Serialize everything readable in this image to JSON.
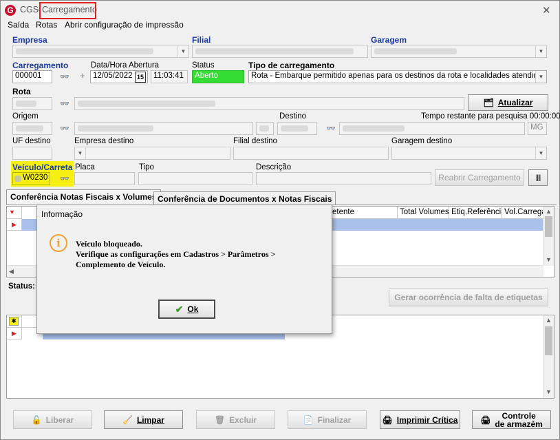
{
  "window": {
    "logo": "G",
    "app_name": "CGS",
    "separator": "-",
    "title": "Carregamento",
    "close_glyph": "✕"
  },
  "menu": [
    "Saída",
    "Rotas",
    "Abrir configuração de impressão"
  ],
  "labels": {
    "empresa": "Empresa",
    "filial": "Filial",
    "garagem": "Garagem",
    "carregamento": "Carregamento",
    "data_hora": "Data/Hora Abertura",
    "status": "Status",
    "tipo_carregamento": "Tipo de carregamento",
    "rota": "Rota",
    "origem": "Origem",
    "destino": "Destino",
    "tempo_restante": "Tempo restante para pesquisa 00:00:00",
    "uf_destino": "UF destino",
    "empresa_destino": "Empresa destino",
    "filial_destino": "Filial destino",
    "garagem_destino": "Garagem destino",
    "veiculo_carreta": "Veículo/Carreta",
    "placa": "Placa",
    "tipo": "Tipo",
    "descricao": "Descrição",
    "status_bottom": "Status:"
  },
  "fields": {
    "carregamento": "000001",
    "date": "12/05/2022",
    "calendar": "15",
    "time": "11:03:41",
    "status": "Aberto",
    "tipo_carregamento": "Rota - Embarque permitido apenas para os destinos da rota e localidades atendidas",
    "uf": "MG",
    "veiculo": "W0230"
  },
  "buttons": {
    "atualizar": "Atualizar",
    "reabrir": "Reabrir Carregamento",
    "gerar_ocorrencia": "Gerar ocorrência de falta de etiquetas",
    "liberar": "Liberar",
    "limpar": "Limpar",
    "excluir": "Excluir",
    "finalizar": "Finalizar",
    "imprimir": "Imprimir Crítica",
    "controle_1": "Controle",
    "controle_2": "de armazém"
  },
  "tabs": [
    "Conferência Notas Fiscais x Volumes",
    "Conferência de Documentos x Notas Fiscais"
  ],
  "grid_headers": [
    "etente",
    "Total Volumes",
    "Etiq.Referência",
    "Vol.Carregad"
  ],
  "dialog": {
    "title": "Informação",
    "line1": "Veículo bloqueado.",
    "line2": "Verifique as configurações em Cadastros > Parâmetros >",
    "line3": "Complemento de Veículo.",
    "ok": "Ok"
  },
  "colors": {
    "status_green": "#33dd33",
    "label_blue": "#1a3aa8",
    "highlight_yellow": "#f5ef12",
    "selection_red": "#e02020",
    "row_blue": "#a9c0ea",
    "info_orange": "#f0a030"
  }
}
